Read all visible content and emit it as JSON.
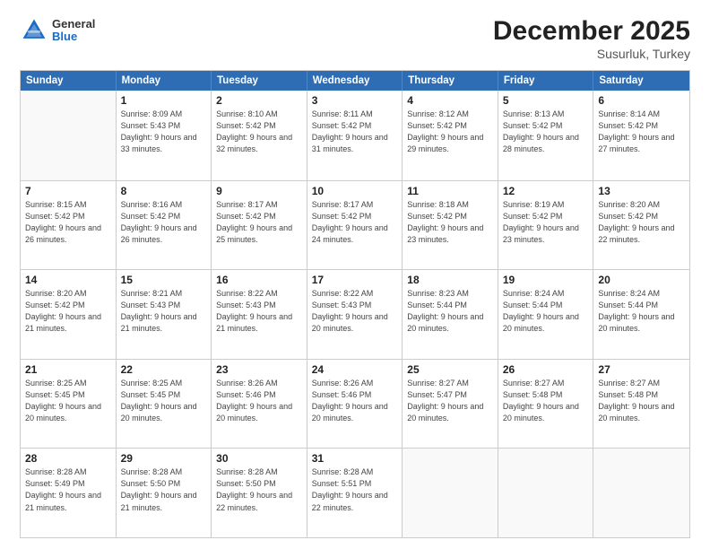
{
  "logo": {
    "general": "General",
    "blue": "Blue"
  },
  "title": {
    "month": "December 2025",
    "location": "Susurluk, Turkey"
  },
  "header_days": [
    "Sunday",
    "Monday",
    "Tuesday",
    "Wednesday",
    "Thursday",
    "Friday",
    "Saturday"
  ],
  "weeks": [
    [
      {
        "day": "",
        "sunrise": "",
        "sunset": "",
        "daylight": "",
        "empty": true
      },
      {
        "day": "1",
        "sunrise": "Sunrise: 8:09 AM",
        "sunset": "Sunset: 5:43 PM",
        "daylight": "Daylight: 9 hours and 33 minutes.",
        "empty": false
      },
      {
        "day": "2",
        "sunrise": "Sunrise: 8:10 AM",
        "sunset": "Sunset: 5:42 PM",
        "daylight": "Daylight: 9 hours and 32 minutes.",
        "empty": false
      },
      {
        "day": "3",
        "sunrise": "Sunrise: 8:11 AM",
        "sunset": "Sunset: 5:42 PM",
        "daylight": "Daylight: 9 hours and 31 minutes.",
        "empty": false
      },
      {
        "day": "4",
        "sunrise": "Sunrise: 8:12 AM",
        "sunset": "Sunset: 5:42 PM",
        "daylight": "Daylight: 9 hours and 29 minutes.",
        "empty": false
      },
      {
        "day": "5",
        "sunrise": "Sunrise: 8:13 AM",
        "sunset": "Sunset: 5:42 PM",
        "daylight": "Daylight: 9 hours and 28 minutes.",
        "empty": false
      },
      {
        "day": "6",
        "sunrise": "Sunrise: 8:14 AM",
        "sunset": "Sunset: 5:42 PM",
        "daylight": "Daylight: 9 hours and 27 minutes.",
        "empty": false
      }
    ],
    [
      {
        "day": "7",
        "sunrise": "Sunrise: 8:15 AM",
        "sunset": "Sunset: 5:42 PM",
        "daylight": "Daylight: 9 hours and 26 minutes.",
        "empty": false
      },
      {
        "day": "8",
        "sunrise": "Sunrise: 8:16 AM",
        "sunset": "Sunset: 5:42 PM",
        "daylight": "Daylight: 9 hours and 26 minutes.",
        "empty": false
      },
      {
        "day": "9",
        "sunrise": "Sunrise: 8:17 AM",
        "sunset": "Sunset: 5:42 PM",
        "daylight": "Daylight: 9 hours and 25 minutes.",
        "empty": false
      },
      {
        "day": "10",
        "sunrise": "Sunrise: 8:17 AM",
        "sunset": "Sunset: 5:42 PM",
        "daylight": "Daylight: 9 hours and 24 minutes.",
        "empty": false
      },
      {
        "day": "11",
        "sunrise": "Sunrise: 8:18 AM",
        "sunset": "Sunset: 5:42 PM",
        "daylight": "Daylight: 9 hours and 23 minutes.",
        "empty": false
      },
      {
        "day": "12",
        "sunrise": "Sunrise: 8:19 AM",
        "sunset": "Sunset: 5:42 PM",
        "daylight": "Daylight: 9 hours and 23 minutes.",
        "empty": false
      },
      {
        "day": "13",
        "sunrise": "Sunrise: 8:20 AM",
        "sunset": "Sunset: 5:42 PM",
        "daylight": "Daylight: 9 hours and 22 minutes.",
        "empty": false
      }
    ],
    [
      {
        "day": "14",
        "sunrise": "Sunrise: 8:20 AM",
        "sunset": "Sunset: 5:42 PM",
        "daylight": "Daylight: 9 hours and 21 minutes.",
        "empty": false
      },
      {
        "day": "15",
        "sunrise": "Sunrise: 8:21 AM",
        "sunset": "Sunset: 5:43 PM",
        "daylight": "Daylight: 9 hours and 21 minutes.",
        "empty": false
      },
      {
        "day": "16",
        "sunrise": "Sunrise: 8:22 AM",
        "sunset": "Sunset: 5:43 PM",
        "daylight": "Daylight: 9 hours and 21 minutes.",
        "empty": false
      },
      {
        "day": "17",
        "sunrise": "Sunrise: 8:22 AM",
        "sunset": "Sunset: 5:43 PM",
        "daylight": "Daylight: 9 hours and 20 minutes.",
        "empty": false
      },
      {
        "day": "18",
        "sunrise": "Sunrise: 8:23 AM",
        "sunset": "Sunset: 5:44 PM",
        "daylight": "Daylight: 9 hours and 20 minutes.",
        "empty": false
      },
      {
        "day": "19",
        "sunrise": "Sunrise: 8:24 AM",
        "sunset": "Sunset: 5:44 PM",
        "daylight": "Daylight: 9 hours and 20 minutes.",
        "empty": false
      },
      {
        "day": "20",
        "sunrise": "Sunrise: 8:24 AM",
        "sunset": "Sunset: 5:44 PM",
        "daylight": "Daylight: 9 hours and 20 minutes.",
        "empty": false
      }
    ],
    [
      {
        "day": "21",
        "sunrise": "Sunrise: 8:25 AM",
        "sunset": "Sunset: 5:45 PM",
        "daylight": "Daylight: 9 hours and 20 minutes.",
        "empty": false
      },
      {
        "day": "22",
        "sunrise": "Sunrise: 8:25 AM",
        "sunset": "Sunset: 5:45 PM",
        "daylight": "Daylight: 9 hours and 20 minutes.",
        "empty": false
      },
      {
        "day": "23",
        "sunrise": "Sunrise: 8:26 AM",
        "sunset": "Sunset: 5:46 PM",
        "daylight": "Daylight: 9 hours and 20 minutes.",
        "empty": false
      },
      {
        "day": "24",
        "sunrise": "Sunrise: 8:26 AM",
        "sunset": "Sunset: 5:46 PM",
        "daylight": "Daylight: 9 hours and 20 minutes.",
        "empty": false
      },
      {
        "day": "25",
        "sunrise": "Sunrise: 8:27 AM",
        "sunset": "Sunset: 5:47 PM",
        "daylight": "Daylight: 9 hours and 20 minutes.",
        "empty": false
      },
      {
        "day": "26",
        "sunrise": "Sunrise: 8:27 AM",
        "sunset": "Sunset: 5:48 PM",
        "daylight": "Daylight: 9 hours and 20 minutes.",
        "empty": false
      },
      {
        "day": "27",
        "sunrise": "Sunrise: 8:27 AM",
        "sunset": "Sunset: 5:48 PM",
        "daylight": "Daylight: 9 hours and 20 minutes.",
        "empty": false
      }
    ],
    [
      {
        "day": "28",
        "sunrise": "Sunrise: 8:28 AM",
        "sunset": "Sunset: 5:49 PM",
        "daylight": "Daylight: 9 hours and 21 minutes.",
        "empty": false
      },
      {
        "day": "29",
        "sunrise": "Sunrise: 8:28 AM",
        "sunset": "Sunset: 5:50 PM",
        "daylight": "Daylight: 9 hours and 21 minutes.",
        "empty": false
      },
      {
        "day": "30",
        "sunrise": "Sunrise: 8:28 AM",
        "sunset": "Sunset: 5:50 PM",
        "daylight": "Daylight: 9 hours and 22 minutes.",
        "empty": false
      },
      {
        "day": "31",
        "sunrise": "Sunrise: 8:28 AM",
        "sunset": "Sunset: 5:51 PM",
        "daylight": "Daylight: 9 hours and 22 minutes.",
        "empty": false
      },
      {
        "day": "",
        "sunrise": "",
        "sunset": "",
        "daylight": "",
        "empty": true
      },
      {
        "day": "",
        "sunrise": "",
        "sunset": "",
        "daylight": "",
        "empty": true
      },
      {
        "day": "",
        "sunrise": "",
        "sunset": "",
        "daylight": "",
        "empty": true
      }
    ]
  ]
}
